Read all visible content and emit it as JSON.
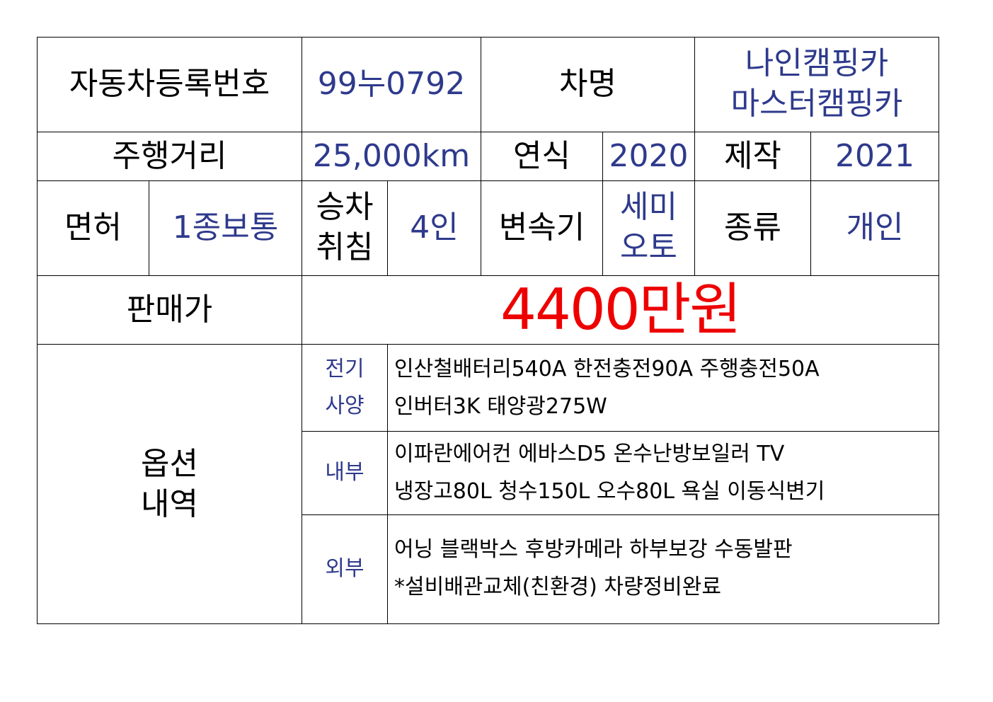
{
  "colors": {
    "label": "#000000",
    "value": "#2e3a8c",
    "price": "#ee0000",
    "border": "#000000"
  },
  "row1": {
    "reg_label": "자동차등록번호",
    "reg_value": "99누0792",
    "name_label": "차명",
    "name_line1": "나인캠핑카",
    "name_line2": "마스터캠핑카"
  },
  "row2": {
    "mileage_label": "주행거리",
    "mileage_value": "25,000km",
    "year_label": "연식",
    "year_value": "2020",
    "make_label": "제작",
    "make_value": "2021"
  },
  "row3": {
    "license_label": "면허",
    "license_value": "1종보통",
    "seat_label_line1": "승차",
    "seat_label_line2": "취침",
    "seat_value": "4인",
    "trans_label": "변속기",
    "trans_line1": "세미",
    "trans_line2": "오토",
    "type_label": "종류",
    "type_value": "개인"
  },
  "row4": {
    "price_label": "판매가",
    "price_value": "4400만원"
  },
  "options": {
    "label_line1": "옵션",
    "label_line2": "내역",
    "electric": {
      "label_line1": "전기",
      "label_line2": "사양",
      "line1": "인산철배터리540A 한전충전90A 주행충전50A",
      "line2": "인버터3K 태양광275W"
    },
    "interior": {
      "label": "내부",
      "line1": "이파란에어컨 에바스D5 온수난방보일러 TV",
      "line2": "냉장고80L 청수150L 오수80L 욕실 이동식변기"
    },
    "exterior": {
      "label": "외부",
      "line1": "어닝 블랙박스 후방카메라 하부보강 수동발판",
      "line2": "*설비배관교체(친환경) 차량정비완료"
    }
  }
}
